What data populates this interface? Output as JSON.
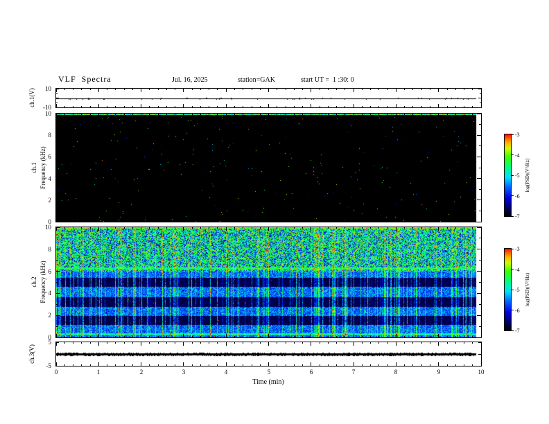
{
  "header": {
    "title": "VLF  Spectra",
    "date": "Jul. 16, 2025",
    "station": "station=GAK",
    "start_ut": "start UT =  1 :30: 0"
  },
  "axes": {
    "time_label": "Time (min)",
    "time_ticks": [
      0,
      1,
      2,
      3,
      4,
      5,
      6,
      7,
      8,
      9,
      10
    ],
    "time_minor_step": 0.2,
    "freq_ticks": [
      0,
      2,
      4,
      6,
      8,
      10
    ],
    "freq_minor_ticks": [
      1,
      3,
      5,
      7,
      9
    ]
  },
  "panels": {
    "ch1v": {
      "label": "ch.1(V)",
      "ymax_label": "10",
      "ymin_label": "-10"
    },
    "spec1": {
      "channel_label": "ch.1",
      "axis_label": "Frequency (kHz)"
    },
    "spec2": {
      "channel_label": "ch.2",
      "axis_label": "Frequency (kHz)"
    },
    "ch3v": {
      "label": "ch.3(V)",
      "ymax_label": "5",
      "ymin_label": "-5"
    }
  },
  "colorbar": {
    "label": "log(PSD)(V²/Hz)",
    "tick_labels": [
      "-3",
      "-4",
      "-5",
      "-6",
      "-7"
    ],
    "vmin": -7,
    "vmax": -3,
    "stops": [
      {
        "v": -7.0,
        "c": "#000000"
      },
      {
        "v": -6.6,
        "c": "#000060"
      },
      {
        "v": -6.1,
        "c": "#0000e0"
      },
      {
        "v": -5.6,
        "c": "#0060ff"
      },
      {
        "v": -5.1,
        "c": "#00e0ff"
      },
      {
        "v": -4.6,
        "c": "#00ff80"
      },
      {
        "v": -4.1,
        "c": "#40ff00"
      },
      {
        "v": -3.7,
        "c": "#c8ff00"
      },
      {
        "v": -3.4,
        "c": "#ffb000"
      },
      {
        "v": -3.15,
        "c": "#ff5000"
      },
      {
        "v": -3.0,
        "c": "#ff0000"
      }
    ]
  },
  "chart_data": [
    {
      "id": "ch1_voltage",
      "type": "line",
      "ylabel": "ch.1(V)",
      "xlabel": "Time (min)",
      "xlim": [
        0,
        10
      ],
      "ylim": [
        -10,
        10
      ],
      "data_end_min": 9.9,
      "series": [
        {
          "name": "ch.1 waveform",
          "level": 0,
          "noise_pp": 0.4,
          "description": "flat trace at ~0 V across the full 10 min record"
        }
      ]
    },
    {
      "id": "ch1_spectrogram",
      "type": "heatmap",
      "channel": "ch.1",
      "ylabel": "Frequency (kHz)",
      "xlabel": "Time (min)",
      "xlim": [
        0,
        10
      ],
      "ylim": [
        0,
        10
      ],
      "zlim": [
        -7,
        -3
      ],
      "zlabel": "log(PSD)(V²/Hz)",
      "data_end_min": 9.9,
      "background_level": -7,
      "top_edge_band": {
        "freq_khz": [
          9.85,
          10
        ],
        "level": [
          -5.4,
          -3.2
        ],
        "bright_fraction": 0.3
      },
      "speckle": {
        "probability": 0.0025,
        "level": [
          -6.3,
          -3.3
        ]
      },
      "description": "entire band at noise floor (black) except a narrow multicolored enhancement at 10 kHz and very sparse speckles"
    },
    {
      "id": "ch2_spectrogram",
      "type": "heatmap",
      "channel": "ch.2",
      "ylabel": "Frequency (kHz)",
      "xlabel": "Time (min)",
      "xlim": [
        0,
        10
      ],
      "ylim": [
        0,
        10
      ],
      "zlim": [
        -7,
        -3
      ],
      "zlabel": "log(PSD)(V²/Hz)",
      "data_end_min": 9.9,
      "upper_band": {
        "freq_khz": [
          6,
          10
        ],
        "base_level": -6.2,
        "speckle_span": 2.8,
        "green_fraction": 0.35,
        "green_level": [
          -4.9,
          -4.0
        ]
      },
      "lower_background": {
        "level": [
          -6.1,
          -5.3
        ],
        "cyan_fraction": 0.18,
        "cyan_level": [
          -5.3,
          -4.8
        ]
      },
      "dark_bands": {
        "centers_khz": [
          1.5,
          3.2,
          5.0
        ],
        "halfwidth_khz": 0.42,
        "level": [
          -6.85,
          -6.5
        ]
      },
      "bright_lines_khz": [
        6.25,
        0.25
      ],
      "streaks": {
        "density": 0.22,
        "boost": [
          0.8,
          2.4
        ]
      },
      "red_specks": {
        "probability": 0.0015,
        "level": [
          -3.25,
          -3.0
        ]
      },
      "description": "broadband impulsive vertical streaks (sferics) across 0-10 kHz, green speckled band above 6 kHz, dark horizontal bands near 1.5, 3.2 and 5 kHz, scattered red pixels"
    },
    {
      "id": "ch3_voltage",
      "type": "line",
      "ylabel": "ch.3(V)",
      "xlabel": "Time (min)",
      "xlim": [
        0,
        10
      ],
      "ylim": [
        -5,
        5
      ],
      "data_end_min": 9.9,
      "series": [
        {
          "name": "ch.3 waveform",
          "level": 0,
          "noise_pp": 1.0,
          "description": "flat noisy (thick) trace at ~0 V across the full 10 min record"
        }
      ]
    }
  ]
}
